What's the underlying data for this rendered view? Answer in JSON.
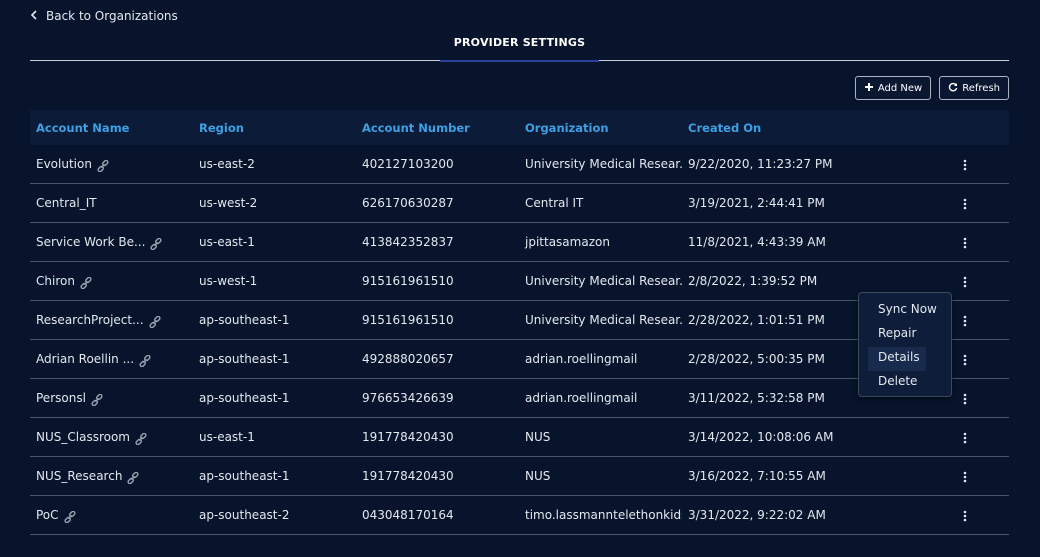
{
  "nav": {
    "back_label": "Back to Organizations"
  },
  "tabs": {
    "active_label": "PROVIDER SETTINGS"
  },
  "toolbar": {
    "add_label": "Add New",
    "refresh_label": "Refresh"
  },
  "table": {
    "headers": [
      "Account Name",
      "Region",
      "Account Number",
      "Organization",
      "Created On"
    ],
    "rows": [
      {
        "name": "Evolution",
        "region": "us-east-2",
        "account": "402127103200",
        "org": "University Medical Resear...",
        "created": "9/22/2020, 11:23:27 PM",
        "linked": true
      },
      {
        "name": "Central_IT",
        "region": "us-west-2",
        "account": "626170630287",
        "org": "Central IT",
        "created": "3/19/2021, 2:44:41 PM",
        "linked": false
      },
      {
        "name": "Service Work Be...",
        "region": "us-east-1",
        "account": "413842352837",
        "org": "jpittasamazon",
        "created": "11/8/2021, 4:43:39 AM",
        "linked": true
      },
      {
        "name": "Chiron",
        "region": "us-west-1",
        "account": "915161961510",
        "org": "University Medical Resear...",
        "created": "2/8/2022, 1:39:52 PM",
        "linked": true
      },
      {
        "name": "ResearchProject...",
        "region": "ap-southeast-1",
        "account": "915161961510",
        "org": "University Medical Resear...",
        "created": "2/28/2022, 1:01:51 PM",
        "linked": true
      },
      {
        "name": "Adrian Roellin ...",
        "region": "ap-southeast-1",
        "account": "492888020657",
        "org": "adrian.roellingmail",
        "created": "2/28/2022, 5:00:35 PM",
        "linked": true
      },
      {
        "name": "Personsl",
        "region": "ap-southeast-1",
        "account": "976653426639",
        "org": "adrian.roellingmail",
        "created": "3/11/2022, 5:32:58 PM",
        "linked": true
      },
      {
        "name": "NUS_Classroom",
        "region": "us-east-1",
        "account": "191778420430",
        "org": "NUS",
        "created": "3/14/2022, 10:08:06 AM",
        "linked": true
      },
      {
        "name": "NUS_Research",
        "region": "ap-southeast-1",
        "account": "191778420430",
        "org": "NUS",
        "created": "3/16/2022, 7:10:55 AM",
        "linked": true
      },
      {
        "name": "PoC",
        "region": "ap-southeast-2",
        "account": "043048170164",
        "org": "timo.lassmanntelethonkids",
        "created": "3/31/2022, 9:22:02 AM",
        "linked": true
      }
    ]
  },
  "context_menu": {
    "items": [
      "Sync Now",
      "Repair",
      "Details",
      "Delete"
    ],
    "highlighted": "Details"
  },
  "colors": {
    "background": "#07142b",
    "header_row": "#0c1c38",
    "header_text": "#3ea0e4",
    "tab_underline": "#2e3f9e"
  }
}
